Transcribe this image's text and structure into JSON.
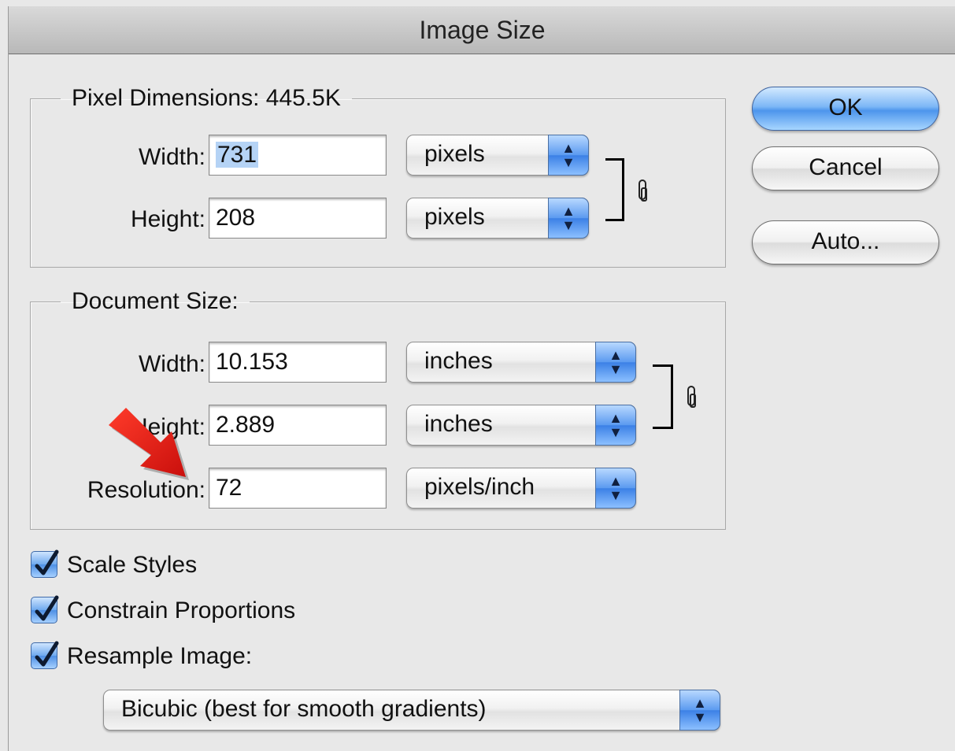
{
  "window": {
    "title": "Image Size"
  },
  "pixel_dimensions": {
    "legend": "Pixel Dimensions:  445.5K",
    "width": {
      "label": "Width:",
      "value": "731",
      "unit": "pixels"
    },
    "height": {
      "label": "Height:",
      "value": "208",
      "unit": "pixels"
    }
  },
  "document_size": {
    "legend": "Document Size:",
    "width": {
      "label": "Width:",
      "value": "10.153",
      "unit": "inches"
    },
    "height": {
      "label": "Height:",
      "value": "2.889",
      "unit": "inches"
    },
    "resolution": {
      "label": "Resolution:",
      "value": "72",
      "unit": "pixels/inch"
    }
  },
  "buttons": {
    "ok": "OK",
    "cancel": "Cancel",
    "auto": "Auto..."
  },
  "options": {
    "scale_styles": {
      "label": "Scale Styles",
      "checked": true
    },
    "constrain_proportions": {
      "label": "Constrain Proportions",
      "checked": true
    },
    "resample_image": {
      "label": "Resample Image:",
      "checked": true
    }
  },
  "resample_method": "Bicubic (best for smooth gradients)",
  "colors": {
    "accent": "#4d95ec",
    "annotation_arrow": "#e0201a"
  },
  "icons": {
    "link": "chain-link-icon",
    "popup": "up-down-arrows-icon",
    "check": "checkmark-icon",
    "annotation": "red-arrow-icon"
  }
}
